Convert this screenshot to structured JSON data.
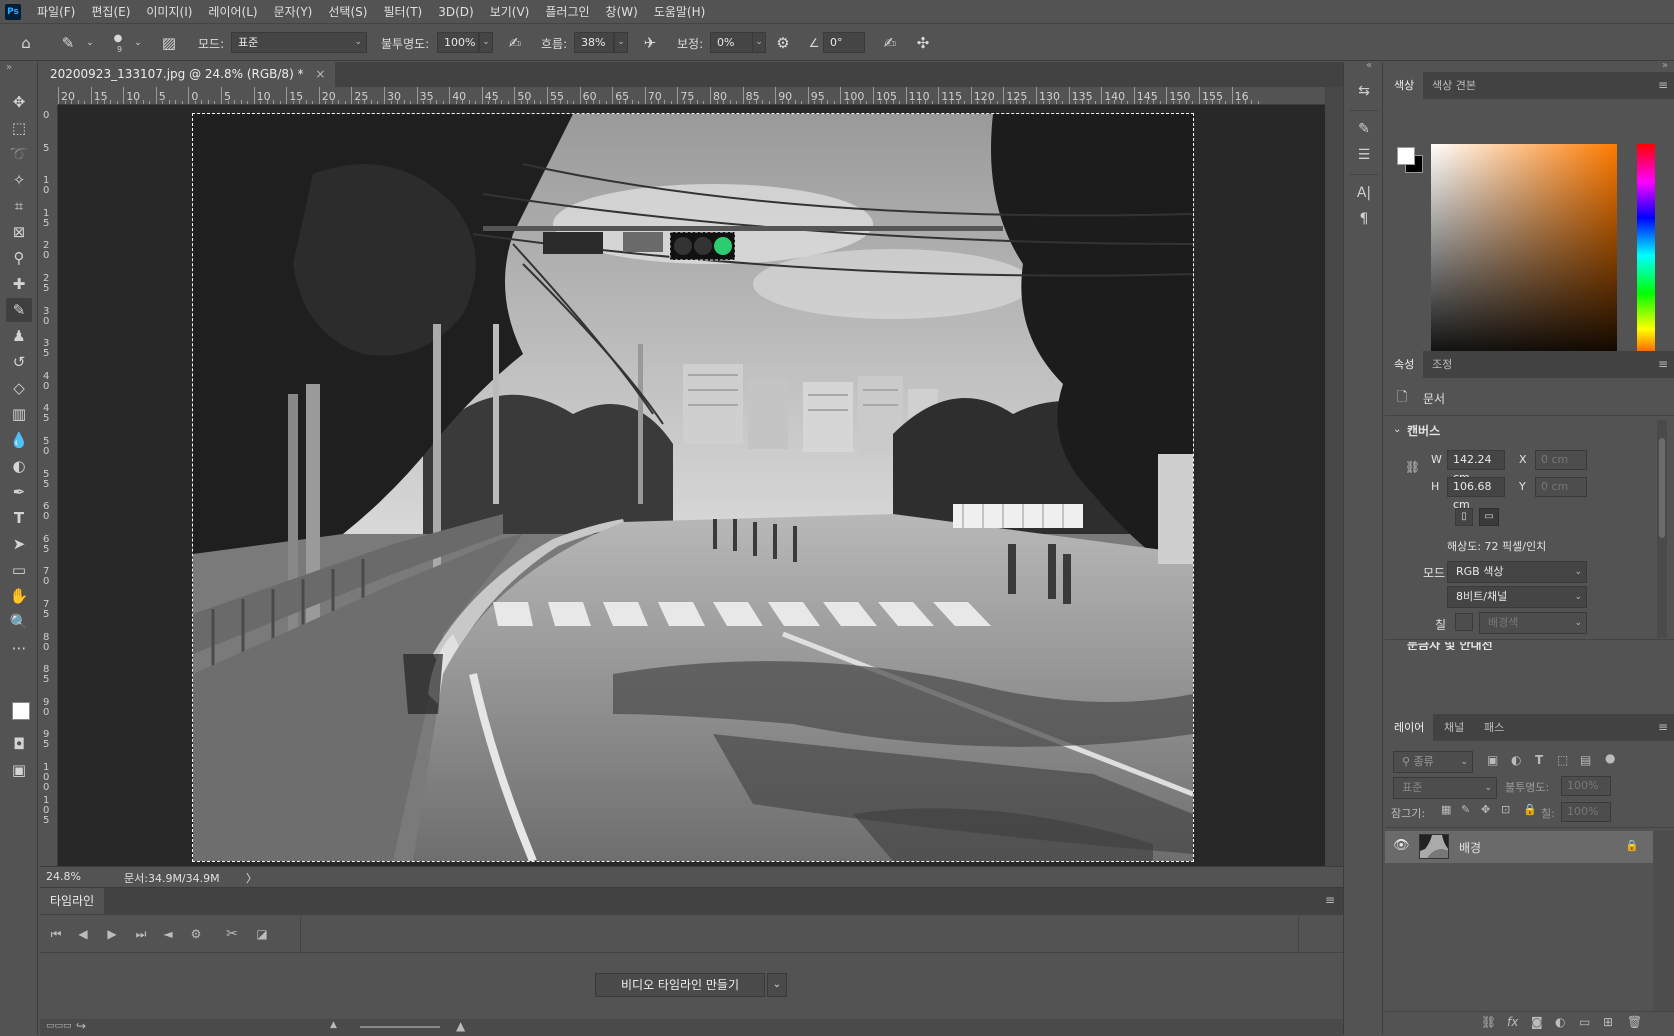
{
  "app": {
    "logo": "Ps"
  },
  "menu": [
    "파일(F)",
    "편집(E)",
    "이미지(I)",
    "레이어(L)",
    "문자(Y)",
    "선택(S)",
    "필터(T)",
    "3D(D)",
    "보기(V)",
    "플러그인",
    "창(W)",
    "도움말(H)"
  ],
  "options": {
    "brush_size": "9",
    "mode_label": "모드:",
    "mode_value": "표준",
    "opacity_label": "불투명도:",
    "opacity_value": "100%",
    "flow_label": "흐름:",
    "flow_value": "38%",
    "smoothing_label": "보정:",
    "smoothing_value": "0%",
    "angle_value": "0°"
  },
  "document": {
    "tab_title": "20200923_133107.jpg @ 24.8% (RGB/8) *",
    "close": "×",
    "zoom": "24.8%",
    "doc_size": "문서:34.9M/34.9M",
    "status_arrow": "〉"
  },
  "ruler": {
    "h_labels": [
      "20",
      "15",
      "10",
      "5",
      "0",
      "5",
      "10",
      "15",
      "20",
      "25",
      "30",
      "35",
      "40",
      "45",
      "50",
      "55",
      "60",
      "65",
      "70",
      "75",
      "80",
      "85",
      "90",
      "95",
      "100",
      "105",
      "110",
      "115",
      "120",
      "125",
      "130",
      "135",
      "140",
      "145",
      "150",
      "155",
      "16"
    ],
    "v_labels": [
      "0",
      "5",
      "10",
      "15",
      "20",
      "25",
      "30",
      "35",
      "40",
      "45",
      "50",
      "55",
      "60",
      "65",
      "70",
      "75",
      "80",
      "85",
      "90",
      "95",
      "100",
      "105"
    ]
  },
  "timeline": {
    "tab": "타임라인",
    "create_button": "비디오 타임라인 만들기",
    "menu": "≡"
  },
  "color_panel": {
    "tabs": [
      "색상",
      "색상 견본"
    ]
  },
  "properties_panel": {
    "tabs": [
      "속성",
      "조정"
    ],
    "doc_label": "문서",
    "section": "캔버스",
    "w_label": "W",
    "w_value": "142.24 cm",
    "h_label": "H",
    "h_value": "106.68 cm",
    "x_label": "X",
    "x_value": "0 cm",
    "y_label": "Y",
    "y_value": "0 cm",
    "resolution": "해상도: 72 픽셀/인치",
    "mode_label": "모드",
    "mode_value": "RGB 색상",
    "bit_value": "8비트/채널",
    "fill_label": "칠",
    "fill_value": "배경색",
    "next_section": "눈금자 및 안내선"
  },
  "layers_panel": {
    "tabs": [
      "레이어",
      "채널",
      "패스"
    ],
    "filter_label": "종류",
    "blend_mode": "표준",
    "opacity_label": "불투명도:",
    "opacity_value": "100%",
    "lock_label": "잠그기:",
    "fill_label": "칠:",
    "fill_value": "100%",
    "layer_name": "배경"
  },
  "colors": {
    "ui_bg": "#535353",
    "canvas_bg": "#282828",
    "traffic_green": "#2ecc71"
  }
}
